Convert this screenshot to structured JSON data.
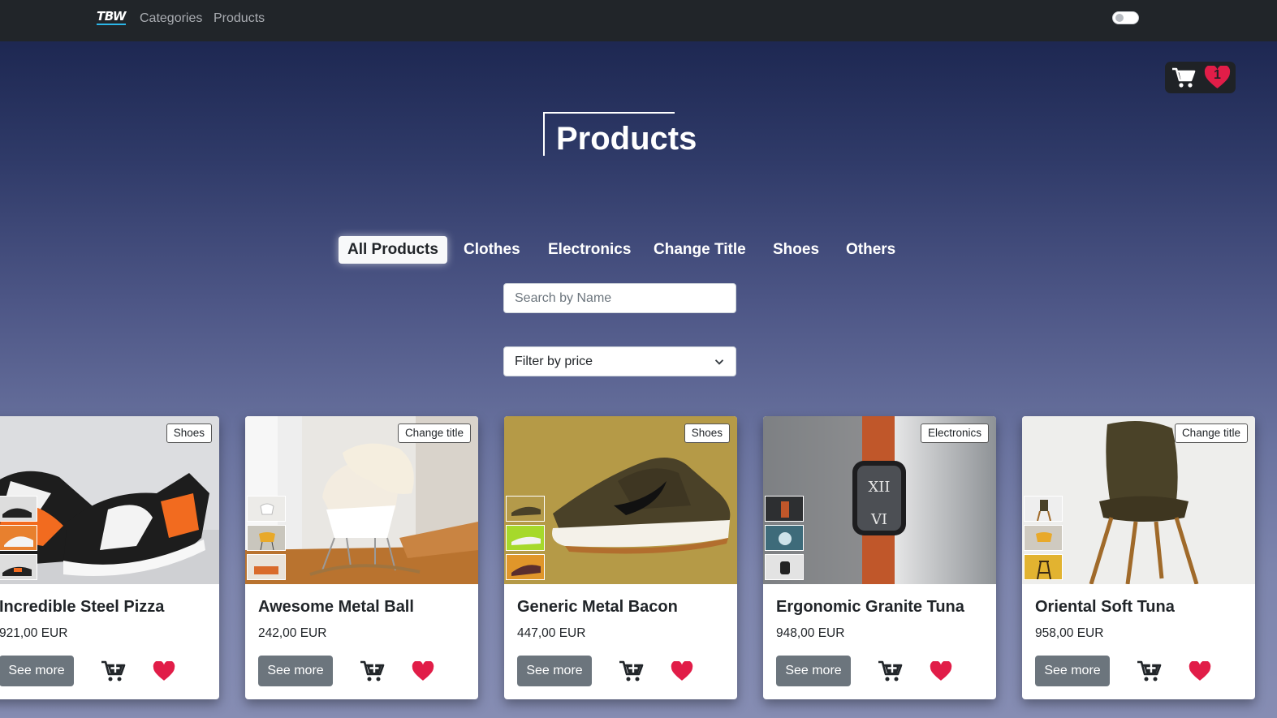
{
  "navbar": {
    "brand": "TBW",
    "links": [
      "Categories",
      "Products"
    ],
    "theme_toggle": "off"
  },
  "cart_panel": {
    "cart_icon": "cart-icon",
    "favorites_count": "1",
    "colors": {
      "panel": "#1f2226",
      "heart": "#e11d48"
    }
  },
  "page_title": "Products",
  "tabs": [
    {
      "label": "All Products",
      "active": true
    },
    {
      "label": "Clothes",
      "active": false
    },
    {
      "label": "Electronics",
      "active": false
    },
    {
      "label": "Change Title",
      "active": false
    },
    {
      "label": "Shoes",
      "active": false
    },
    {
      "label": "Others",
      "active": false
    }
  ],
  "search": {
    "placeholder": "Search by Name",
    "value": ""
  },
  "price_filter": {
    "selected": "Filter by price"
  },
  "products": [
    {
      "category": "Shoes",
      "name": "Incredible Steel Pizza",
      "price": "921,00 EUR",
      "see_more": "See more"
    },
    {
      "category": "Change title",
      "name": "Awesome Metal Ball",
      "price": "242,00 EUR",
      "see_more": "See more"
    },
    {
      "category": "Shoes",
      "name": "Generic Metal Bacon",
      "price": "447,00 EUR",
      "see_more": "See more"
    },
    {
      "category": "Electronics",
      "name": "Ergonomic Granite Tuna",
      "price": "948,00 EUR",
      "see_more": "See more"
    },
    {
      "category": "Change title",
      "name": "Oriental Soft Tuna",
      "price": "958,00 EUR",
      "see_more": "See more"
    }
  ]
}
